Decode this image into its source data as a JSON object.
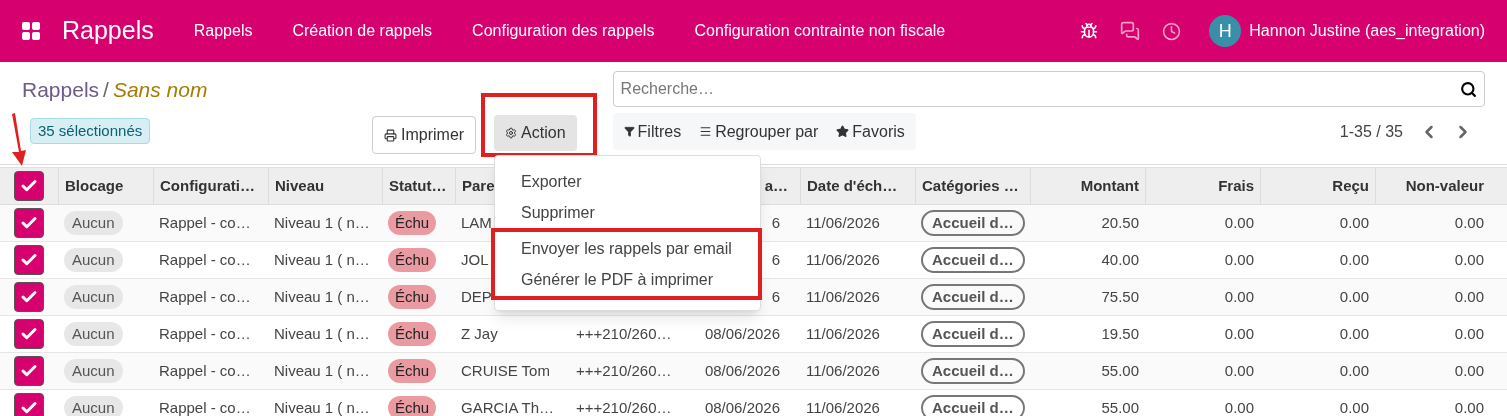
{
  "topbar": {
    "app_title": "Rappels",
    "menu": [
      "Rappels",
      "Création de rappels",
      "Configuration des rappels",
      "Configuration contrainte non fiscale"
    ],
    "user": {
      "initial": "H",
      "name": "Hannon Justine (aes_integration)"
    }
  },
  "breadcrumb": {
    "parent": "Rappels",
    "separator": "/",
    "current": "Sans nom"
  },
  "selection_badge": "35 sélectionnés",
  "buttons": {
    "print": "Imprimer",
    "action": "Action",
    "action_highlighted": true
  },
  "search": {
    "placeholder": "Recherche…"
  },
  "filters": [
    "Filtres",
    "Regrouper par",
    "Favoris"
  ],
  "pager": "1-35 / 35",
  "action_menu": {
    "items": [
      {
        "label": "Exporter",
        "highlighted": false
      },
      {
        "label": "Supprimer",
        "highlighted": false
      },
      {
        "label": "Envoyer les rappels par email",
        "highlighted": true
      },
      {
        "label": "Générer le PDF à imprimer",
        "highlighted": true
      }
    ]
  },
  "table": {
    "all_checked": true,
    "columns": [
      "Blocage",
      "Configurati…",
      "Niveau",
      "Statut…",
      "Pare",
      "",
      "a…",
      "Date d'éch…",
      "Catégories …",
      "Montant",
      "Frais",
      "Reçu",
      "Non-valeur"
    ],
    "rows": [
      {
        "checked": true,
        "cells": [
          "Aucun",
          "Rappel - co…",
          "Niveau 1 ( n…",
          "Échu",
          "LAM",
          "",
          "6",
          "11/06/2026",
          "Accueil d…",
          "20.50",
          "0.00",
          "0.00",
          "0.00"
        ]
      },
      {
        "checked": true,
        "cells": [
          "Aucun",
          "Rappel - co…",
          "Niveau 1 ( n…",
          "Échu",
          "JOL",
          "",
          "6",
          "11/06/2026",
          "Accueil d…",
          "40.00",
          "0.00",
          "0.00",
          "0.00"
        ]
      },
      {
        "checked": true,
        "cells": [
          "Aucun",
          "Rappel - co…",
          "Niveau 1 ( n…",
          "Échu",
          "DEP",
          "",
          "6",
          "11/06/2026",
          "Accueil d…",
          "75.50",
          "0.00",
          "0.00",
          "0.00"
        ]
      },
      {
        "checked": true,
        "cells": [
          "Aucun",
          "Rappel - co…",
          "Niveau 1 ( n…",
          "Échu",
          "Z Jay",
          "+++210/260…",
          "08/06/2026",
          "11/06/2026",
          "Accueil d…",
          "19.50",
          "0.00",
          "0.00",
          "0.00"
        ]
      },
      {
        "checked": true,
        "cells": [
          "Aucun",
          "Rappel - co…",
          "Niveau 1 ( n…",
          "Échu",
          "CRUISE Tom",
          "+++210/260…",
          "08/06/2026",
          "11/06/2026",
          "Accueil d…",
          "55.00",
          "0.00",
          "0.00",
          "0.00"
        ]
      },
      {
        "checked": true,
        "cells": [
          "Aucun",
          "Rappel - co…",
          "Niveau 1 ( n…",
          "Échu",
          "GARCIA Th…",
          "+++210/260…",
          "08/06/2026",
          "11/06/2026",
          "Accueil d…",
          "55.00",
          "0.00",
          "0.00",
          "0.00"
        ]
      }
    ]
  }
}
